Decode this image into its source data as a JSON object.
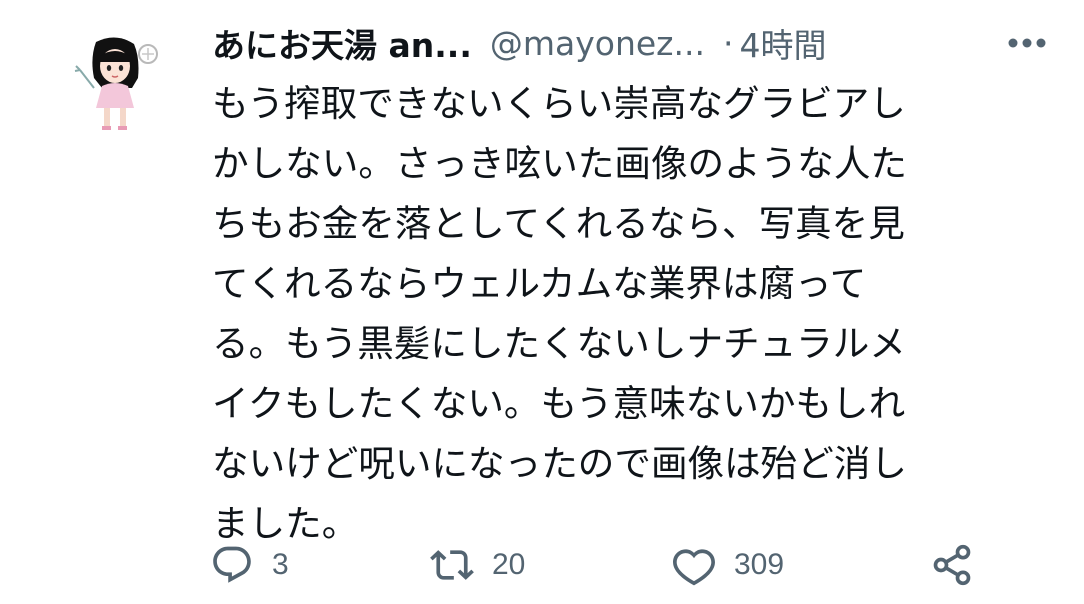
{
  "tweet": {
    "display_name": "あにお天湯 an...",
    "handle": "@mayonez...",
    "separator": "·",
    "time": "4時間",
    "text": "もう搾取できないくらい崇高なグラビアし\nかしない。さっき呟いた画像のような人た\nちもお金を落としてくれるなら、写真を見\nてくれるならウェルカムな業界は腐って\nる。もう黒髪にしたくないしナチュラルメ\nイクもしたくない。もう意味ないかもしれ\nないけど呪いになったので画像は殆ど消し\nました。"
  },
  "actions": {
    "reply_count": "3",
    "retweet_count": "20",
    "like_count": "309"
  },
  "icons": {
    "more": "more-dots-icon",
    "reply": "reply-icon",
    "retweet": "retweet-icon",
    "like": "heart-icon",
    "share": "share-icon"
  },
  "colors": {
    "text": "#0f1419",
    "secondary": "#536471",
    "background": "#ffffff"
  }
}
